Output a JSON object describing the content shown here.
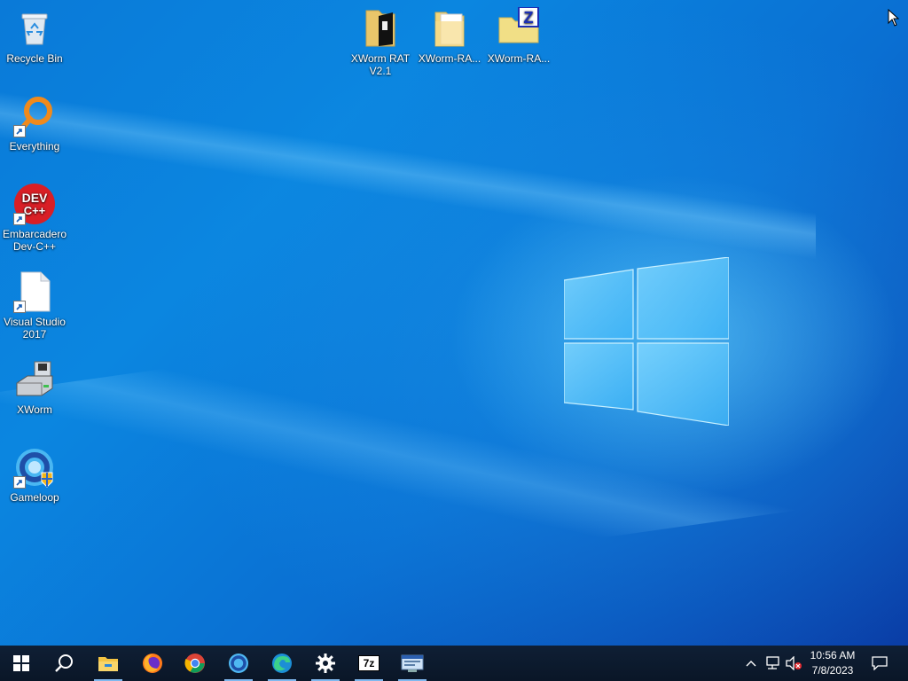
{
  "desktop": {
    "icons_left": [
      {
        "label": "Recycle Bin",
        "icon": "recycle-bin-icon",
        "shortcut": false
      },
      {
        "label": "Everything",
        "icon": "everything-search-icon",
        "shortcut": true
      },
      {
        "label": "Embarcadero Dev-C++",
        "icon": "devcpp-icon",
        "shortcut": true,
        "badge_text": "DEV C++"
      },
      {
        "label": "Visual Studio 2017",
        "icon": "blank-file-icon",
        "shortcut": true
      },
      {
        "label": "XWorm",
        "icon": "xworm-drive-icon",
        "shortcut": false
      },
      {
        "label": "Gameloop",
        "icon": "gameloop-icon",
        "shortcut": true
      }
    ],
    "icons_top": [
      {
        "label": "XWorm RAT V2.1",
        "icon": "folder-icon"
      },
      {
        "label": "XWorm-RA...",
        "icon": "folder-icon"
      },
      {
        "label": "XWorm-RA...",
        "icon": "zip-folder-icon",
        "badge_text": "Z"
      }
    ]
  },
  "taskbar": {
    "buttons": [
      {
        "name": "start-button",
        "icon": "windows-logo-icon"
      },
      {
        "name": "search-button",
        "icon": "search-icon"
      },
      {
        "name": "file-explorer-button",
        "icon": "folder-icon",
        "active": true
      },
      {
        "name": "firefox-button",
        "icon": "firefox-icon"
      },
      {
        "name": "chrome-button",
        "icon": "chrome-icon"
      },
      {
        "name": "gameloop-button",
        "icon": "gameloop-icon",
        "active": true
      },
      {
        "name": "edge-button",
        "icon": "edge-icon",
        "active": true
      },
      {
        "name": "settings-button",
        "icon": "gear-icon",
        "active": true
      },
      {
        "name": "7zip-button",
        "icon": "7zip-icon",
        "text": "7z",
        "active": true
      },
      {
        "name": "app-window-button",
        "icon": "window-app-icon",
        "active": true
      }
    ],
    "tray": {
      "icons": [
        "chevron-up-icon",
        "network-icon",
        "speaker-muted-icon"
      ],
      "time": "10:56 AM",
      "date": "7/8/2023",
      "notification_icon": "notification-icon"
    }
  },
  "colors": {
    "desktop_blue": "#0a7ad8",
    "taskbar": "#0c1a2e",
    "active_indicator": "#7fb8ee"
  }
}
